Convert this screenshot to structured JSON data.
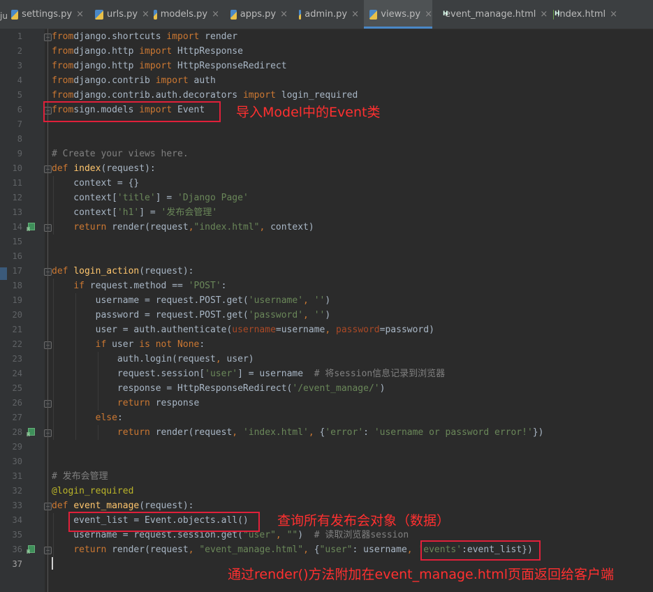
{
  "tabs": [
    {
      "label": "settings.py",
      "type": "py",
      "active": false
    },
    {
      "label": "urls.py",
      "type": "py",
      "active": false
    },
    {
      "label": "models.py",
      "type": "py",
      "active": false
    },
    {
      "label": "apps.py",
      "type": "py",
      "active": false
    },
    {
      "label": "admin.py",
      "type": "py",
      "active": false
    },
    {
      "label": "views.py",
      "type": "py",
      "active": true
    },
    {
      "label": "event_manage.html",
      "type": "html",
      "active": false
    },
    {
      "label": "index.html",
      "type": "html",
      "active": false
    }
  ],
  "left_cut_text": "ju",
  "editor": {
    "current_line": 37,
    "lines": [
      [
        [
          "kw",
          "from"
        ],
        [
          "",
          "django.shortcuts "
        ],
        [
          "kw",
          "import"
        ],
        [
          "",
          " render"
        ]
      ],
      [
        [
          "kw",
          "from"
        ],
        [
          "",
          "django.http "
        ],
        [
          "kw",
          "import"
        ],
        [
          "",
          " HttpResponse"
        ]
      ],
      [
        [
          "kw",
          "from"
        ],
        [
          "",
          "django.http "
        ],
        [
          "kw",
          "import"
        ],
        [
          "",
          " HttpResponseRedirect"
        ]
      ],
      [
        [
          "kw",
          "from"
        ],
        [
          "",
          "django.contrib "
        ],
        [
          "kw",
          "import"
        ],
        [
          "",
          " auth"
        ]
      ],
      [
        [
          "kw",
          "from"
        ],
        [
          "",
          "django.contrib.auth.decorators "
        ],
        [
          "kw",
          "import"
        ],
        [
          "",
          " login_required"
        ]
      ],
      [
        [
          "kw",
          "from"
        ],
        [
          "",
          "sign.models "
        ],
        [
          "kw",
          "import"
        ],
        [
          "",
          " Event"
        ]
      ],
      [],
      [],
      [
        [
          "cm",
          "# Create your views here."
        ]
      ],
      [
        [
          "kw",
          "def "
        ],
        [
          "fn",
          "index"
        ],
        [
          "",
          "(request):"
        ]
      ],
      [
        [
          "",
          "    context = {}"
        ]
      ],
      [
        [
          "",
          "    context["
        ],
        [
          "str",
          "'title'"
        ],
        [
          "",
          "] = "
        ],
        [
          "str",
          "'Django Page'"
        ]
      ],
      [
        [
          "",
          "    context["
        ],
        [
          "str",
          "'h1'"
        ],
        [
          "",
          "] = "
        ],
        [
          "str",
          "'发布会管理'"
        ]
      ],
      [
        [
          "",
          "    "
        ],
        [
          "kw",
          "return"
        ],
        [
          "",
          " render(request"
        ],
        [
          "kw",
          ","
        ],
        [
          " ",
          ""
        ],
        [
          "str",
          "\"index.html\""
        ],
        [
          "kw",
          ","
        ],
        [
          "",
          " context)"
        ]
      ],
      [],
      [],
      [
        [
          "kw",
          "def "
        ],
        [
          "fn",
          "login_action"
        ],
        [
          "",
          "(request):"
        ]
      ],
      [
        [
          "",
          "    "
        ],
        [
          "kw",
          "if"
        ],
        [
          "",
          " request.method == "
        ],
        [
          "str",
          "'POST'"
        ],
        [
          "",
          ":"
        ]
      ],
      [
        [
          "",
          "        username = request.POST.get("
        ],
        [
          "str",
          "'username'"
        ],
        [
          "kw",
          ","
        ],
        [
          "",
          " "
        ],
        [
          "str",
          "''"
        ],
        [
          "",
          ")"
        ]
      ],
      [
        [
          "",
          "        password = request.POST.get("
        ],
        [
          "str",
          "'password'"
        ],
        [
          "kw",
          ","
        ],
        [
          "",
          " "
        ],
        [
          "str",
          "''"
        ],
        [
          "",
          ")"
        ]
      ],
      [
        [
          "",
          "        user = auth.authenticate("
        ],
        [
          "prm",
          "username"
        ],
        [
          "",
          "=username"
        ],
        [
          "kw",
          ","
        ],
        [
          "",
          " "
        ],
        [
          "prm",
          "password"
        ],
        [
          "",
          "=password)"
        ]
      ],
      [
        [
          "",
          "        "
        ],
        [
          "kw",
          "if"
        ],
        [
          "",
          " user "
        ],
        [
          "kw",
          "is not None"
        ],
        [
          "",
          ":"
        ]
      ],
      [
        [
          "",
          "            auth.login(request"
        ],
        [
          "kw",
          ","
        ],
        [
          "",
          " user)"
        ]
      ],
      [
        [
          "",
          "            request.session["
        ],
        [
          "str",
          "'user'"
        ],
        [
          "",
          "] = username  "
        ],
        [
          "cm",
          "# 将session信息记录到浏览器"
        ]
      ],
      [
        [
          "",
          "            response = HttpResponseRedirect("
        ],
        [
          "str",
          "'/event_manage/'"
        ],
        [
          "",
          ")"
        ]
      ],
      [
        [
          "",
          "            "
        ],
        [
          "kw",
          "return"
        ],
        [
          "",
          " response"
        ]
      ],
      [
        [
          "",
          "        "
        ],
        [
          "kw",
          "else"
        ],
        [
          "",
          ":"
        ]
      ],
      [
        [
          "",
          "            "
        ],
        [
          "kw",
          "return"
        ],
        [
          "",
          " render(request"
        ],
        [
          "kw",
          ","
        ],
        [
          "",
          " "
        ],
        [
          "str",
          "'index.html'"
        ],
        [
          "kw",
          ","
        ],
        [
          "",
          " {"
        ],
        [
          "str",
          "'error'"
        ],
        [
          "",
          ": "
        ],
        [
          "str",
          "'username or password error!'"
        ],
        [
          "",
          "})"
        ]
      ],
      [],
      [],
      [
        [
          "cm",
          "# 发布会管理"
        ]
      ],
      [
        [
          "dec",
          "@login_required"
        ]
      ],
      [
        [
          "kw",
          "def "
        ],
        [
          "fn",
          "event_manage"
        ],
        [
          "",
          "(request):"
        ]
      ],
      [
        [
          "",
          "    event_list = Event.objects.all()"
        ]
      ],
      [
        [
          "",
          "    username = request.session.get("
        ],
        [
          "str",
          "\"user\""
        ],
        [
          "kw",
          ","
        ],
        [
          "",
          " "
        ],
        [
          "str",
          "\"\""
        ],
        [
          "",
          ")  "
        ],
        [
          "cm",
          "# 读取浏览器session"
        ]
      ],
      [
        [
          "",
          "    "
        ],
        [
          "kw",
          "return"
        ],
        [
          "",
          " render(request"
        ],
        [
          "kw",
          ","
        ],
        [
          "",
          " "
        ],
        [
          "str",
          "\"event_manage.html\""
        ],
        [
          "kw",
          ","
        ],
        [
          "",
          " {"
        ],
        [
          "str",
          "\"user\""
        ],
        [
          "",
          ": username"
        ],
        [
          "kw",
          ","
        ],
        [
          "",
          " "
        ],
        [
          "str",
          "'events'"
        ],
        [
          "",
          ":event_list})"
        ]
      ],
      []
    ]
  },
  "annotations": {
    "import_note": "导入Model中的Event类",
    "query_note": "查询所有发布会对象（数据）",
    "render_note": "通过render()方法附加在event_manage.html页面返回给客户端"
  },
  "colors": {
    "background": "#2b2b2b",
    "keyword": "#cc7832",
    "function": "#ffc66d",
    "string": "#6a8759",
    "comment": "#808080",
    "decorator": "#bbb529",
    "annotation_red": "#ff3030"
  },
  "icons": {
    "python_file": "python-file-icon",
    "html_file": "html-file-icon",
    "close": "close-icon",
    "gutter_impl": "html-template-gutter-icon"
  }
}
